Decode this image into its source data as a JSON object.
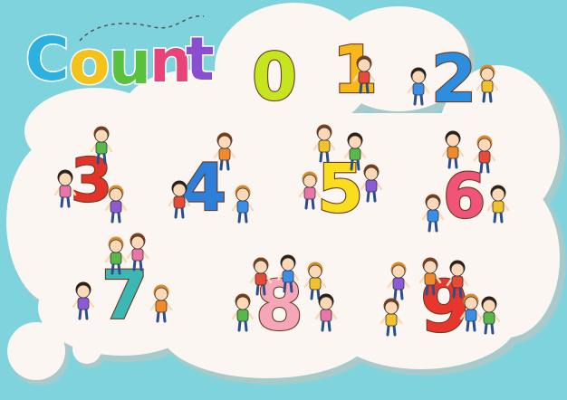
{
  "background_color": "#7fd3dc",
  "cloud_color": "#fbf6f2",
  "cloud_shadow": "#c9c3bd",
  "title": {
    "letters": [
      "C",
      "o",
      "u",
      "n",
      "t"
    ],
    "colors": [
      "#2bb0e0",
      "#f3c21b",
      "#59c13e",
      "#e8447a",
      "#8a4fd0"
    ]
  },
  "numbers": [
    {
      "text": "0",
      "color": "#c5e51f",
      "icon": "kids-cartoon"
    },
    {
      "text": "1",
      "color": "#f6b81a",
      "icon": "kids-cartoon"
    },
    {
      "text": "2",
      "color": "#2d8ee0",
      "icon": "kids-cartoon"
    },
    {
      "text": "3",
      "color": "#e2342a",
      "icon": "kids-cartoon"
    },
    {
      "text": "4",
      "color": "#2d7fd9",
      "icon": "kids-cartoon"
    },
    {
      "text": "5",
      "color": "#f8de1e",
      "icon": "kids-cartoon"
    },
    {
      "text": "6",
      "color": "#f05478",
      "icon": "kids-cartoon"
    },
    {
      "text": "7",
      "color": "#3cb7b4",
      "icon": "kids-cartoon"
    },
    {
      "text": "8",
      "color": "#f5a7b9",
      "icon": "kids-cartoon"
    },
    {
      "text": "9",
      "color": "#e9362d",
      "icon": "kids-cartoon"
    }
  ]
}
